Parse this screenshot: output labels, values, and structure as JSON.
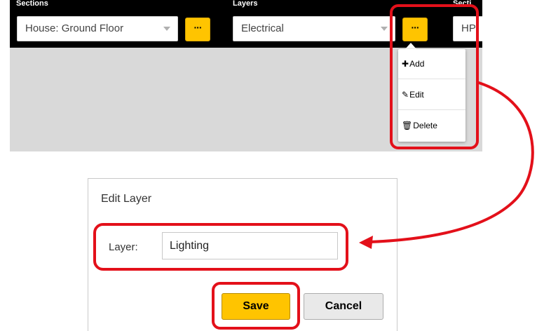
{
  "toolbar": {
    "sections_label": "Sections",
    "sections_value": "House: Ground Floor",
    "layers_label": "Layers",
    "layers_value": "Electrical",
    "third_label": "Secti",
    "third_value": "HP",
    "more_label": "···"
  },
  "menu": {
    "items": [
      {
        "icon": "✚",
        "label": "Add"
      },
      {
        "icon": "✎",
        "label": "Edit"
      },
      {
        "icon": "🗑",
        "label": "Delete"
      }
    ]
  },
  "dialog": {
    "title": "Edit Layer",
    "field_label": "Layer:",
    "field_value": "Lighting",
    "save_label": "Save",
    "cancel_label": "Cancel"
  },
  "colors": {
    "accent": "#ffc400",
    "annotation": "#e3101a",
    "toolbar_bg": "#000000",
    "canvas_bg": "#d9d9d9"
  }
}
